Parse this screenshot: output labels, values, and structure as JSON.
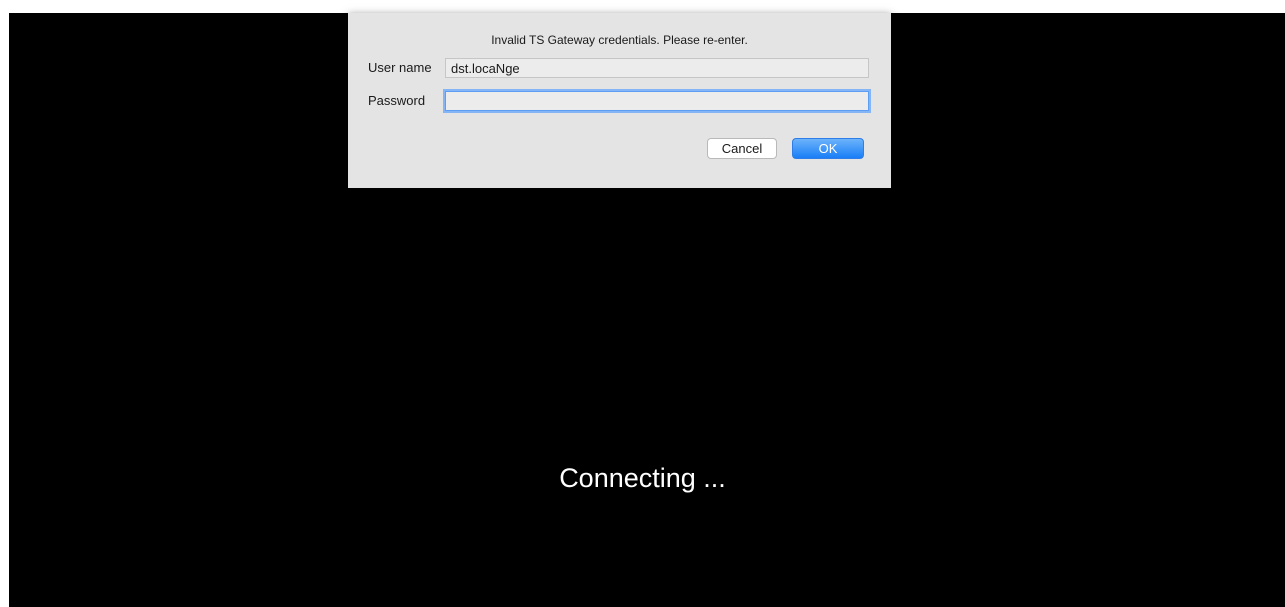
{
  "dialog": {
    "message": "Invalid TS Gateway credentials. Please re-enter.",
    "username_label": "User name",
    "username_value": "dst.locaNge",
    "password_label": "Password",
    "password_value": "",
    "cancel_label": "Cancel",
    "ok_label": "OK"
  },
  "status": {
    "text": "Connecting ..."
  },
  "colors": {
    "background": "#000000",
    "dialog_bg": "#e4e4e4",
    "accent": "#1a7ef7"
  }
}
